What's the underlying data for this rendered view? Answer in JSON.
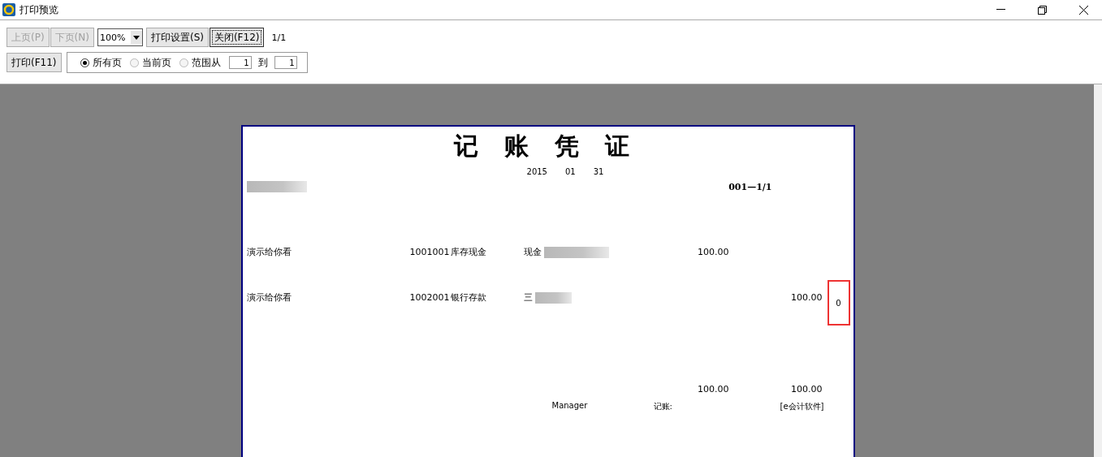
{
  "window": {
    "title": "打印预览"
  },
  "toolbar": {
    "nav_buttons": [
      {
        "label": "上页(P)",
        "disabled": true
      },
      {
        "label": "下页(N)",
        "disabled": true
      }
    ],
    "zoom": "100%",
    "buttons": [
      {
        "label": "打印设置(S)",
        "selected": false
      },
      {
        "label": "关闭(F12)",
        "selected": true
      }
    ],
    "page_count": "1/1",
    "print_button": "打印(F11)",
    "range_options": [
      {
        "label": "所有页",
        "selected": true
      },
      {
        "label": "当前页",
        "selected": false
      },
      {
        "label": "范围从",
        "selected": false
      }
    ],
    "range_from": "1",
    "range_to_label": "到",
    "range_to": "1"
  },
  "voucher": {
    "title": [
      "记",
      "账",
      "凭",
      "证"
    ],
    "date": [
      "2015",
      "01",
      "31"
    ],
    "number": "001—1/1",
    "entries": [
      {
        "description": "演示给你看",
        "code": "1001001",
        "account": "库存现金",
        "summary": "现金",
        "debit": "100.00"
      },
      {
        "description": "演示给你看",
        "code": "1002001",
        "account": "银行存款",
        "summary": "三",
        "credit": "100.00",
        "note": "0",
        "highlighted": true
      }
    ],
    "totals": {
      "debit": "100.00",
      "credit": "100.00"
    },
    "footer": {
      "maker": "Manager",
      "bookkeeper": "记账:",
      "software": "[e会计软件]"
    }
  }
}
